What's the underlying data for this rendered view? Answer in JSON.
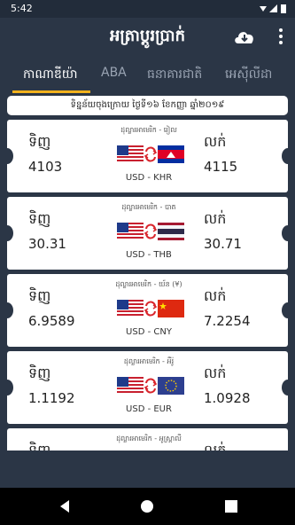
{
  "status_bar": {
    "time": "5:42",
    "icons": "▾◢▮"
  },
  "app_bar": {
    "title": "អត្រាប្តូរប្រាក់"
  },
  "tabs": [
    {
      "label": "កាណាឌីយ៉ា",
      "active": true
    },
    {
      "label": "ABA",
      "active": false
    },
    {
      "label": "ធនាគារជាតិ",
      "active": false
    },
    {
      "label": "អេស៊ីលីដា",
      "active": false
    }
  ],
  "notice": "ទិន្នន័យចុងក្រោយ ថ្ងៃទី១៦ ខែកញ្ញា ឆ្នាំ២០១៩",
  "rates": [
    {
      "bank_label": "ដុល្លារអាមេរិក - រៀល",
      "buy_label": "ទិញ",
      "sell_label": "លក់",
      "buy": "4103",
      "sell": "4115",
      "pair": "USD - KHR",
      "flag_from": "us",
      "flag_to": "kh"
    },
    {
      "bank_label": "ដុល្លារអាមេរិក - បាត",
      "buy_label": "ទិញ",
      "sell_label": "លក់",
      "buy": "30.31",
      "sell": "30.71",
      "pair": "USD - THB",
      "flag_from": "us",
      "flag_to": "th"
    },
    {
      "bank_label": "ដុល្លារអាមេរិក - យ័ន (¥)",
      "buy_label": "ទិញ",
      "sell_label": "លក់",
      "buy": "6.9589",
      "sell": "7.2254",
      "pair": "USD - CNY",
      "flag_from": "us",
      "flag_to": "cn"
    },
    {
      "bank_label": "ដុល្លារអាមេរិក - អឺរ៉ូ",
      "buy_label": "ទិញ",
      "sell_label": "លក់",
      "buy": "1.1192",
      "sell": "1.0928",
      "pair": "USD - EUR",
      "flag_from": "us",
      "flag_to": "eu"
    },
    {
      "bank_label": "ដុល្លារអាមេរិក - អូស្ត្រាលី",
      "buy_label": "ទិញ",
      "sell_label": "លក់",
      "buy": "",
      "sell": "",
      "pair": "",
      "flag_from": "us",
      "flag_to": "au"
    }
  ],
  "colors": {
    "background": "#2b3646",
    "accent": "#f2b21d",
    "swap": "#d9252c"
  },
  "nav": [
    "back-icon",
    "home-icon",
    "recents-icon"
  ]
}
